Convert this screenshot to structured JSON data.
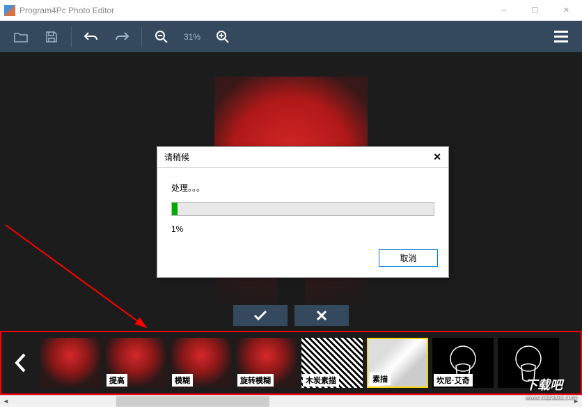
{
  "window": {
    "title": "Program4Pc Photo Editor"
  },
  "toolbar": {
    "zoom_label": "31%"
  },
  "dialog": {
    "title": "请稍候",
    "message": "处理。。。",
    "percent": "1%",
    "cancel_label": "取消"
  },
  "filters": [
    {
      "label": "",
      "type": "bar"
    },
    {
      "label": "提高",
      "type": "red"
    },
    {
      "label": "模糊",
      "type": "red"
    },
    {
      "label": "旋转模糊",
      "type": "red"
    },
    {
      "label": "木炭素描",
      "type": "bw"
    },
    {
      "label": "素描",
      "type": "sketch",
      "selected": true
    },
    {
      "label": "坎尼·艾奇",
      "type": "outline"
    },
    {
      "label": "",
      "type": "outline"
    }
  ],
  "watermark": {
    "main": "下载吧",
    "sub": "www.xiazaiba.com"
  }
}
